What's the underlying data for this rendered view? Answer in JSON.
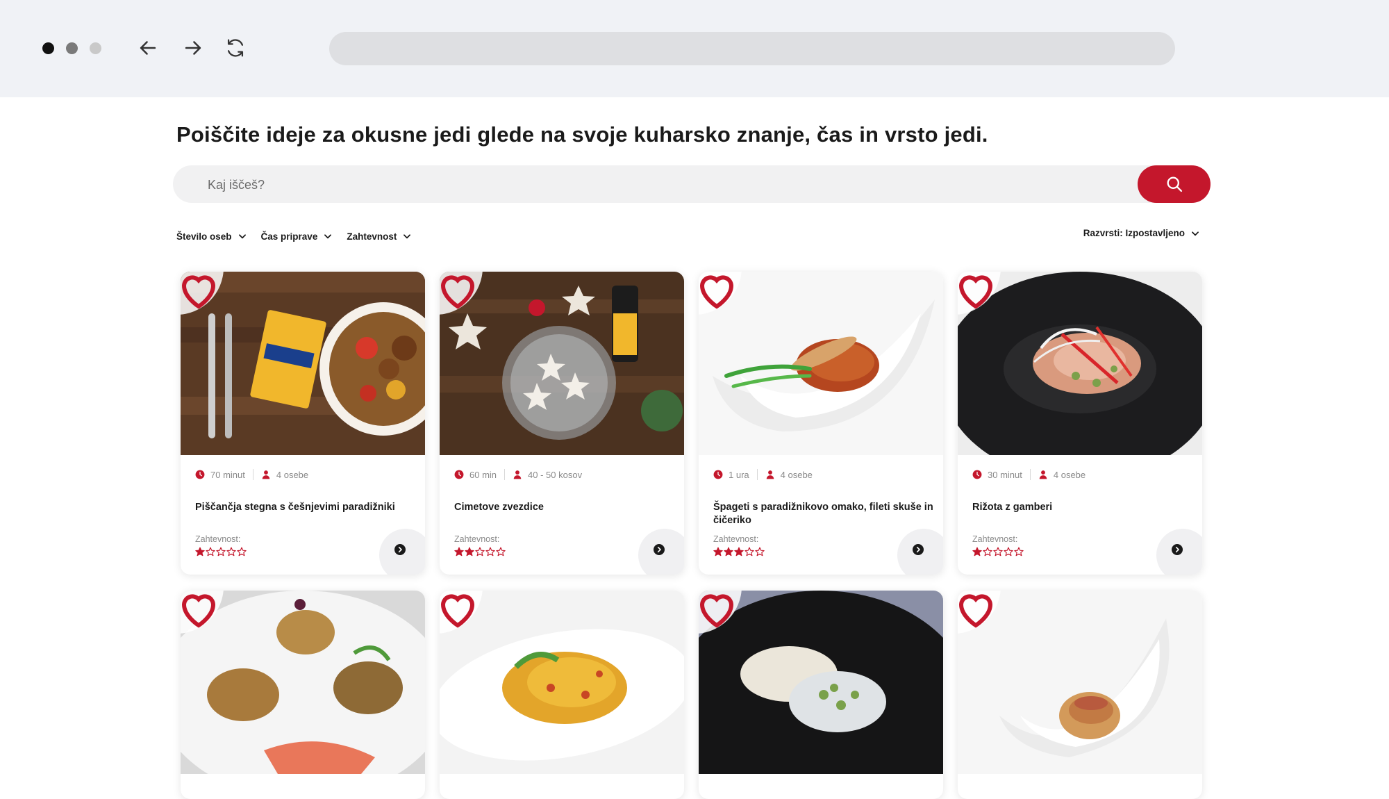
{
  "browser": {
    "window_dots": [
      "close",
      "minimize",
      "maximize"
    ],
    "nav": {
      "back_icon": "arrow-left-icon",
      "forward_icon": "arrow-right-icon",
      "reload_icon": "reload-icon"
    },
    "address": ""
  },
  "page": {
    "headline": "Poiščite ideje za okusne jedi glede na svoje kuharsko znanje, čas in vrsto jedi.",
    "search": {
      "placeholder": "Kaj iščeš?",
      "button_icon": "search-icon"
    },
    "filters": [
      {
        "label": "Število oseb"
      },
      {
        "label": "Čas priprave"
      },
      {
        "label": "Zahtevnost"
      }
    ],
    "sort_label": "Razvrsti: Izpostavljeno",
    "accent_color": "#c4172c",
    "difficulty_label": "Zahtevnost:",
    "recipes": [
      {
        "time": "70 minut",
        "persons": "4 osebe",
        "title": "Piščančja stegna s češnjevimi paradižniki",
        "difficulty": 1
      },
      {
        "time": "60 min",
        "persons": "40 - 50 kosov",
        "title": "Cimetove zvezdice",
        "difficulty": 2
      },
      {
        "time": "1 ura",
        "persons": "4 osebe",
        "title": "Špageti s paradižnikovo omako, fileti skuše in čičeriko",
        "difficulty": 3
      },
      {
        "time": "30 minut",
        "persons": "4 osebe",
        "title": "Rižota z gamberi",
        "difficulty": 1
      },
      {
        "time": "",
        "persons": "",
        "title": "",
        "difficulty": 0
      },
      {
        "time": "",
        "persons": "",
        "title": "",
        "difficulty": 0
      },
      {
        "time": "",
        "persons": "",
        "title": "",
        "difficulty": 0
      },
      {
        "time": "",
        "persons": "",
        "title": "",
        "difficulty": 0
      }
    ]
  }
}
